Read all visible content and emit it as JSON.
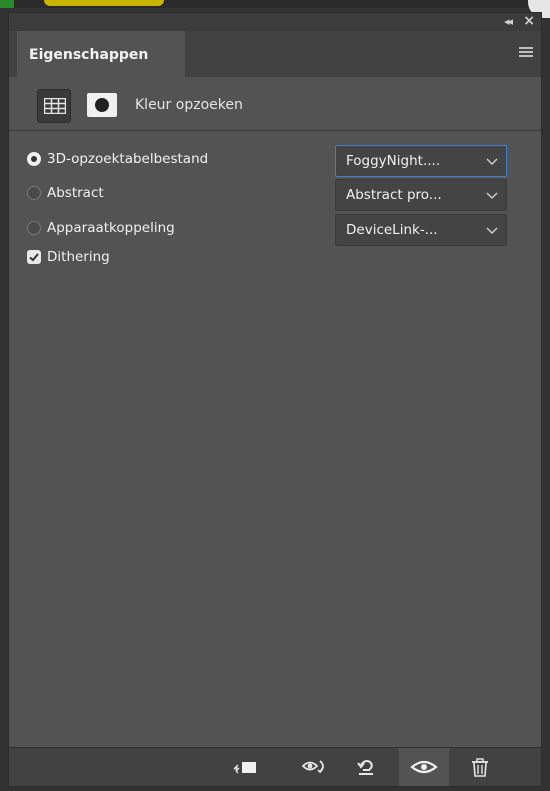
{
  "panel": {
    "tab_label": "Eigenschappen",
    "header_title": "Kleur opzoeken"
  },
  "options": [
    {
      "label": "3D-opzoektabelbestand",
      "selected": true,
      "dropdown": "FoggyNight...."
    },
    {
      "label": "Abstract",
      "selected": false,
      "dropdown": "Abstract pro..."
    },
    {
      "label": "Apparaatkoppeling",
      "selected": false,
      "dropdown": "DeviceLink-..."
    }
  ],
  "dithering": {
    "label": "Dithering",
    "checked": true
  },
  "icons": {
    "collapse": "double-chevron-left-icon",
    "close": "close-icon",
    "menu": "hamburger-menu-icon",
    "adjustment": "lookup-table-grid-icon",
    "mask": "layer-mask-icon",
    "clip": "clip-to-layer-icon",
    "view_previous": "view-previous-state-icon",
    "reset": "reset-icon",
    "visibility": "eye-icon",
    "delete": "trash-icon"
  },
  "colors": {
    "panel_bg": "#535353",
    "accent": "#3f7fd0"
  }
}
